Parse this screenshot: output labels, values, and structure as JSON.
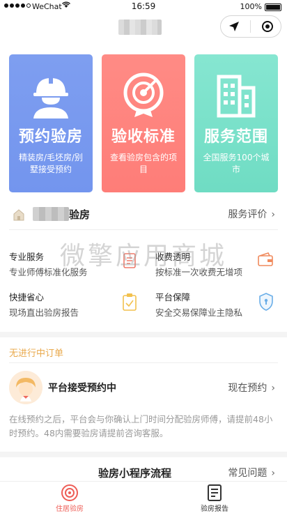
{
  "status_bar": {
    "carrier": "WeChat",
    "time": "16:59",
    "battery": "100%"
  },
  "capsule": {
    "left_icon": "location-arrow-icon",
    "right_icon": "target-circle-icon"
  },
  "cards": [
    {
      "title": "预约验房",
      "subtitle": "精装房/毛坯房/别墅接受预约",
      "icon": "worker-helmet-icon",
      "color": "#7b9bef"
    },
    {
      "title": "验收标准",
      "subtitle": "查看验房包含的项目",
      "icon": "target-badge-icon",
      "color": "#fe8580"
    },
    {
      "title": "服务范围",
      "subtitle": "全国服务100个城市",
      "icon": "buildings-icon",
      "color": "#7ae1ca"
    }
  ],
  "appraise": {
    "label": "验房",
    "link": "服务评价"
  },
  "watermark": "微擎应用商城",
  "features": [
    {
      "title": "专业服务",
      "desc": "专业师傅标准化服务",
      "icon": "document-icon"
    },
    {
      "title": "收费透明",
      "desc": "按标准一次收费无增项",
      "icon": "wallet-icon"
    },
    {
      "title": "快捷省心",
      "desc": "现场直出验房报告",
      "icon": "clipboard-check-icon"
    },
    {
      "title": "平台保障",
      "desc": "安全交易保障业主隐私",
      "icon": "shield-icon"
    }
  ],
  "orders": {
    "section_title": "无进行中订单",
    "status": "平台接受预约中",
    "action": "现在预约",
    "note": "在线预约之后，平台会与你确认上门时间分配验房师傅，请提前48小时预约。48内需要验房请提前咨询客服。"
  },
  "flow": {
    "title": "验房小程序流程",
    "link": "常见问题"
  },
  "tabbar": [
    {
      "label": "住居验房",
      "icon": "target-circle-icon",
      "active": true
    },
    {
      "label": "验房报告",
      "icon": "report-icon",
      "active": false
    }
  ],
  "colors": {
    "accent_red": "#ee5d56",
    "orders_title": "#e9a94c"
  }
}
